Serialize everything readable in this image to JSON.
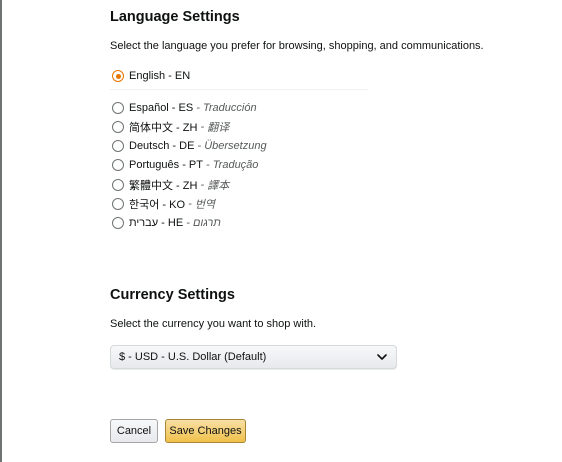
{
  "language_settings": {
    "title": "Language Settings",
    "description": "Select the language you prefer for browsing, shopping, and communications.",
    "selected": "English - EN",
    "options": [
      {
        "label": "English - EN",
        "translation": ""
      },
      {
        "label": "Español - ES",
        "translation": "Traducción"
      },
      {
        "label": "简体中文 - ZH",
        "translation": "翻译"
      },
      {
        "label": "Deutsch - DE",
        "translation": "Übersetzung"
      },
      {
        "label": "Português - PT",
        "translation": "Tradução"
      },
      {
        "label": "繁體中文 - ZH",
        "translation": "譯本"
      },
      {
        "label": "한국어 - KO",
        "translation": "번역"
      },
      {
        "label": "עברית - HE",
        "translation": "תרגום"
      }
    ],
    "separator": " - "
  },
  "currency_settings": {
    "title": "Currency Settings",
    "description": "Select the currency you want to shop with.",
    "selected_value": "$ - USD - U.S. Dollar (Default)"
  },
  "actions": {
    "cancel_label": "Cancel",
    "save_label": "Save Changes"
  },
  "colors": {
    "accent_radio": "#e77600",
    "save_button": "#f0c14b"
  },
  "icons": {
    "select_arrow": "chevron-down-icon"
  }
}
